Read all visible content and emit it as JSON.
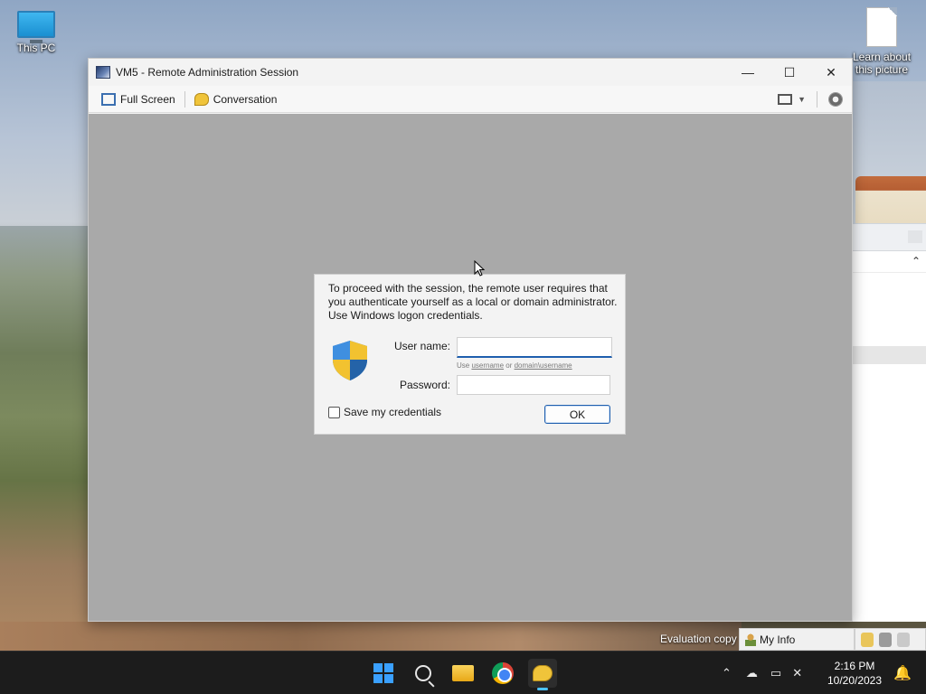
{
  "desktop": {
    "icons": [
      {
        "label": "This PC"
      },
      {
        "label_line1": "Learn about",
        "label_line2": "this picture"
      }
    ]
  },
  "window": {
    "title": "VM5 - Remote Administration Session",
    "controls": {
      "minimize": "—",
      "maximize": "☐",
      "close": "✕"
    },
    "toolbar": {
      "full_screen_label": "Full Screen",
      "conversation_label": "Conversation"
    }
  },
  "dialog": {
    "message": "To proceed with the session, the remote user requires that you authenticate yourself as a local or domain administrator. Use Windows logon credentials.",
    "username_label": "User name:",
    "username_value": "",
    "hint_prefix": "Use ",
    "hint_username": "username",
    "hint_or": " or ",
    "hint_domain": "domain\\username",
    "password_label": "Password:",
    "password_value": "",
    "save_credentials_label": "Save my credentials",
    "save_credentials_checked": false,
    "ok_label": "OK"
  },
  "info_bar": {
    "evaluation_text": "Evaluation copy",
    "my_info_label": "My Info"
  },
  "taskbar": {
    "apps": [
      "start",
      "search",
      "file-explorer",
      "chrome",
      "conversation"
    ],
    "active_app": "conversation",
    "clock": {
      "time": "2:16 PM",
      "date": "10/20/2023"
    }
  },
  "colors": {
    "accent": "#1f5fae",
    "canvas": "#a9a9a9",
    "taskbar": "#1c1c1c"
  }
}
